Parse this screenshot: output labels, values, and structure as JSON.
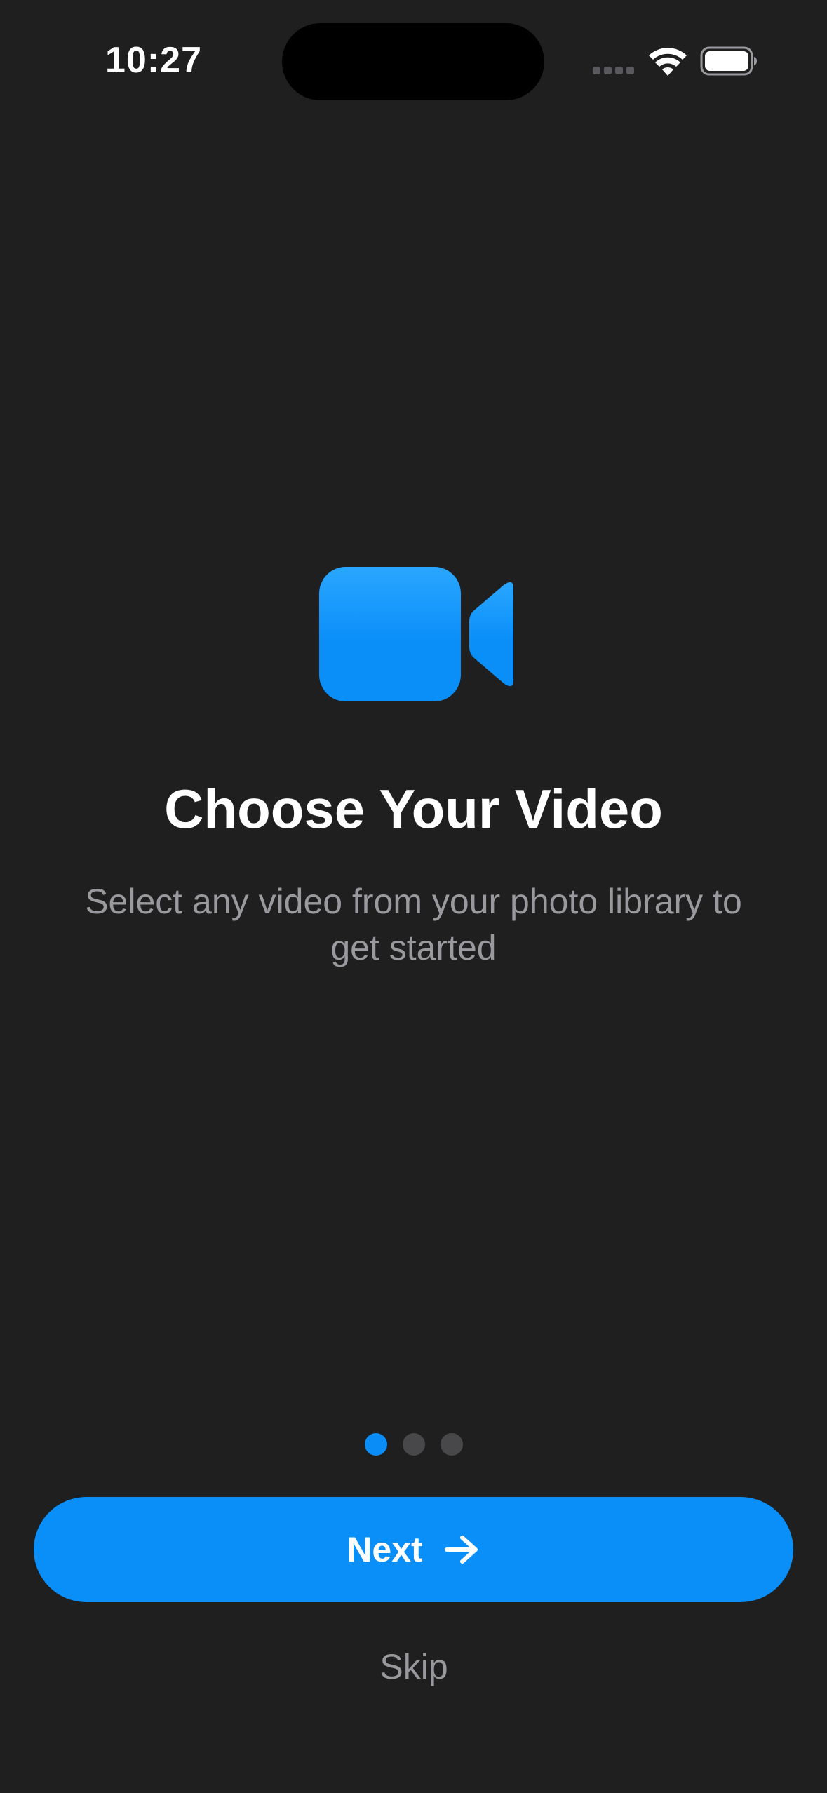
{
  "status_bar": {
    "time": "10:27",
    "icons": [
      "cellular-signal-icon",
      "wifi-icon",
      "battery-icon"
    ]
  },
  "onboarding": {
    "icon": "video-camera-icon",
    "title": "Choose Your Video",
    "subtitle": "Select any video from your photo library to get started",
    "page_index": 1,
    "page_count": 3
  },
  "actions": {
    "next_label": "Next",
    "next_icon": "arrow-right-icon",
    "skip_label": "Skip"
  },
  "colors": {
    "background": "#1f1f1f",
    "accent": "#0a8ff9",
    "secondary_text": "#9a9a9e",
    "inactive_dot": "#48484a"
  }
}
